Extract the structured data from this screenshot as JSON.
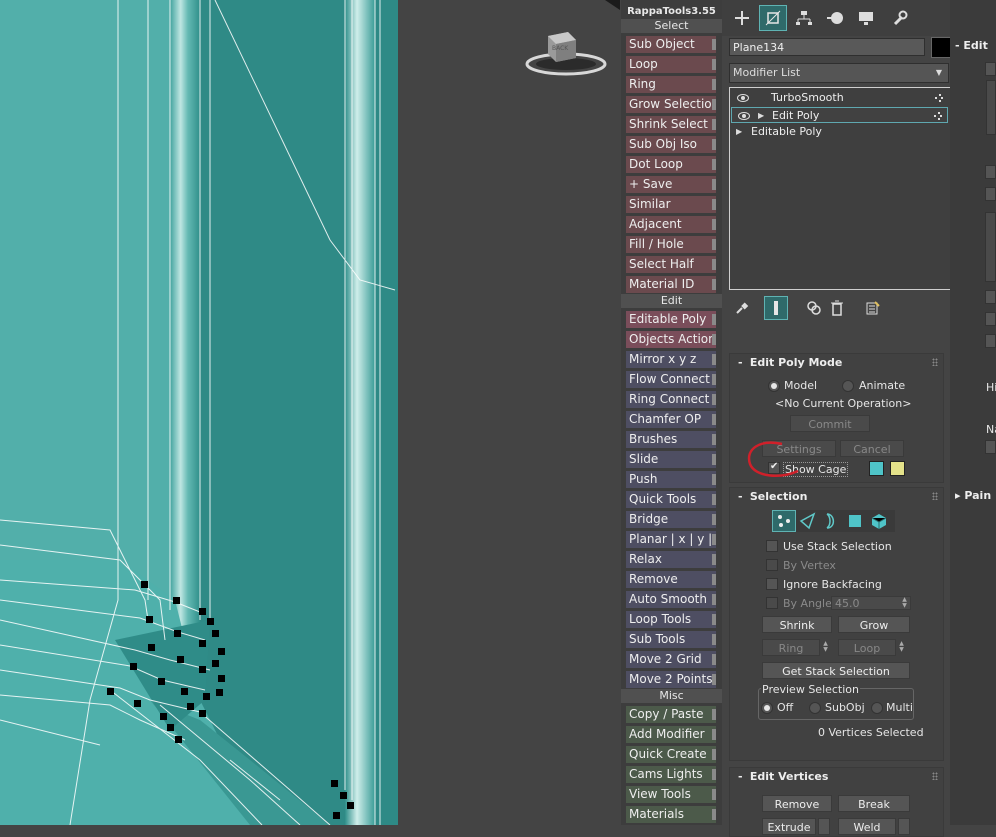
{
  "rappa": {
    "title": "RappaTools3.55",
    "sections": {
      "select": "Select",
      "edit": "Edit",
      "misc": "Misc"
    },
    "select_buttons": [
      "Sub Object",
      "Loop",
      "Ring",
      "Grow Selection",
      "Shrink Select",
      "Sub Obj Iso",
      "Dot Loop",
      "+ Save",
      "Similar",
      "Adjacent",
      "Fill / Hole",
      "Select Half",
      "Material ID"
    ],
    "edit_buttons": [
      "Editable Poly",
      "Objects Actions",
      "Mirror   x  y  z",
      "Flow Connect",
      "Ring Connect",
      "Chamfer OP",
      "Brushes",
      "Slide",
      "Push",
      "Quick Tools",
      "Bridge",
      "Planar | x | y | z",
      "Relax",
      "Remove",
      "Auto Smooth",
      "Loop Tools",
      "Sub Tools",
      "Move 2 Grid",
      "Move 2 Points"
    ],
    "misc_buttons": [
      "Copy / Paste",
      "Add Modifier",
      "Quick Create",
      "Cams Lights",
      "View Tools",
      "Materials"
    ]
  },
  "command_panel": {
    "object_name": "Plane134",
    "object_color": "#000000",
    "modifier_list": "Modifier List",
    "stack": [
      {
        "label": "TurboSmooth",
        "visible": true
      },
      {
        "label": "Edit Poly",
        "visible": true,
        "selected": true
      },
      {
        "label": "Editable Poly"
      }
    ],
    "edit_poly_mode": {
      "title": "Edit Poly Mode",
      "model": "Model",
      "animate": "Animate",
      "operation": "<No Current Operation>",
      "commit": "Commit",
      "settings": "Settings",
      "cancel": "Cancel",
      "show_cage": "Show Cage",
      "cage_color_1": "#4fc4c8",
      "cage_color_2": "#e4e28a"
    },
    "selection": {
      "title": "Selection",
      "use_stack_selection": "Use Stack Selection",
      "by_vertex": "By Vertex",
      "ignore_backfacing": "Ignore Backfacing",
      "by_angle": "By Angle:",
      "angle_value": "45.0",
      "shrink": "Shrink",
      "grow": "Grow",
      "ring": "Ring",
      "loop": "Loop",
      "get_stack_selection": "Get Stack Selection",
      "preview_selection": "Preview Selection",
      "off": "Off",
      "subobj": "SubObj",
      "multi": "Multi",
      "status": "0 Vertices Selected"
    },
    "edit_vertices": {
      "title": "Edit Vertices",
      "remove": "Remove",
      "break": "Break",
      "extrude": "Extrude",
      "weld": "Weld"
    }
  },
  "right_panel": {
    "edit": "Edit",
    "paint": "Pain",
    "hi": "Hi",
    "na": "Na"
  },
  "colors": {
    "teal_accent": "#2f6a6a",
    "mesh_teal": "#3d9d98",
    "annotation_red": "#d0202a"
  }
}
